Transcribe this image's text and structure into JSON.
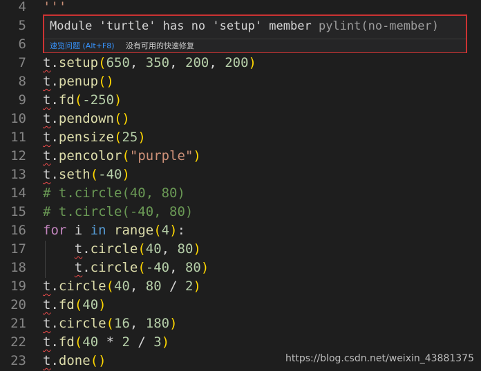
{
  "editor": {
    "lines": [
      {
        "num": "4",
        "tokens": [
          {
            "t": "'''",
            "c": "t-str"
          }
        ]
      },
      {
        "num": "5",
        "tokens": []
      },
      {
        "num": "6",
        "tokens": []
      },
      {
        "num": "7",
        "tokens": [
          {
            "t": "t",
            "c": "t-var squiggle"
          },
          {
            "t": ".",
            "c": "t-op"
          },
          {
            "t": "setup",
            "c": "t-fn"
          },
          {
            "t": "(",
            "c": "t-p1"
          },
          {
            "t": "650",
            "c": "t-num"
          },
          {
            "t": ", ",
            "c": "t-op"
          },
          {
            "t": "350",
            "c": "t-num"
          },
          {
            "t": ", ",
            "c": "t-op"
          },
          {
            "t": "200",
            "c": "t-num"
          },
          {
            "t": ", ",
            "c": "t-op"
          },
          {
            "t": "200",
            "c": "t-num"
          },
          {
            "t": ")",
            "c": "t-p1"
          }
        ]
      },
      {
        "num": "8",
        "tokens": [
          {
            "t": "t",
            "c": "t-var squiggle"
          },
          {
            "t": ".",
            "c": "t-op"
          },
          {
            "t": "penup",
            "c": "t-fn"
          },
          {
            "t": "()",
            "c": "t-p1"
          }
        ]
      },
      {
        "num": "9",
        "tokens": [
          {
            "t": "t",
            "c": "t-var squiggle"
          },
          {
            "t": ".",
            "c": "t-op"
          },
          {
            "t": "fd",
            "c": "t-fn"
          },
          {
            "t": "(",
            "c": "t-p1"
          },
          {
            "t": "-250",
            "c": "t-num"
          },
          {
            "t": ")",
            "c": "t-p1"
          }
        ]
      },
      {
        "num": "10",
        "tokens": [
          {
            "t": "t",
            "c": "t-var squiggle"
          },
          {
            "t": ".",
            "c": "t-op"
          },
          {
            "t": "pendown",
            "c": "t-fn"
          },
          {
            "t": "()",
            "c": "t-p1"
          }
        ]
      },
      {
        "num": "11",
        "tokens": [
          {
            "t": "t",
            "c": "t-var squiggle"
          },
          {
            "t": ".",
            "c": "t-op"
          },
          {
            "t": "pensize",
            "c": "t-fn"
          },
          {
            "t": "(",
            "c": "t-p1"
          },
          {
            "t": "25",
            "c": "t-num"
          },
          {
            "t": ")",
            "c": "t-p1"
          }
        ]
      },
      {
        "num": "12",
        "tokens": [
          {
            "t": "t",
            "c": "t-var squiggle"
          },
          {
            "t": ".",
            "c": "t-op"
          },
          {
            "t": "pencolor",
            "c": "t-fn"
          },
          {
            "t": "(",
            "c": "t-p1"
          },
          {
            "t": "\"purple\"",
            "c": "t-str"
          },
          {
            "t": ")",
            "c": "t-p1"
          }
        ]
      },
      {
        "num": "13",
        "tokens": [
          {
            "t": "t",
            "c": "t-var squiggle"
          },
          {
            "t": ".",
            "c": "t-op"
          },
          {
            "t": "seth",
            "c": "t-fn"
          },
          {
            "t": "(",
            "c": "t-p1"
          },
          {
            "t": "-40",
            "c": "t-num"
          },
          {
            "t": ")",
            "c": "t-p1"
          }
        ]
      },
      {
        "num": "14",
        "tokens": [
          {
            "t": "# t.circle(40, 80)",
            "c": "t-cmt"
          }
        ]
      },
      {
        "num": "15",
        "tokens": [
          {
            "t": "# t.circle(-40, 80)",
            "c": "t-cmt"
          }
        ]
      },
      {
        "num": "16",
        "tokens": [
          {
            "t": "for",
            "c": "t-kw"
          },
          {
            "t": " i ",
            "c": "t-var"
          },
          {
            "t": "in",
            "c": "t-kw2"
          },
          {
            "t": " ",
            "c": "t-op"
          },
          {
            "t": "range",
            "c": "t-fn"
          },
          {
            "t": "(",
            "c": "t-p1"
          },
          {
            "t": "4",
            "c": "t-num"
          },
          {
            "t": ")",
            "c": "t-p1"
          },
          {
            "t": ":",
            "c": "t-op"
          }
        ]
      },
      {
        "num": "17",
        "tokens": [
          {
            "t": "    ",
            "c": "t-op"
          },
          {
            "t": "t",
            "c": "t-var squiggle"
          },
          {
            "t": ".",
            "c": "t-op"
          },
          {
            "t": "circle",
            "c": "t-fn"
          },
          {
            "t": "(",
            "c": "t-p1"
          },
          {
            "t": "40",
            "c": "t-num"
          },
          {
            "t": ", ",
            "c": "t-op"
          },
          {
            "t": "80",
            "c": "t-num"
          },
          {
            "t": ")",
            "c": "t-p1"
          }
        ]
      },
      {
        "num": "18",
        "tokens": [
          {
            "t": "    ",
            "c": "t-op"
          },
          {
            "t": "t",
            "c": "t-var squiggle"
          },
          {
            "t": ".",
            "c": "t-op"
          },
          {
            "t": "circle",
            "c": "t-fn"
          },
          {
            "t": "(",
            "c": "t-p1"
          },
          {
            "t": "-40",
            "c": "t-num"
          },
          {
            "t": ", ",
            "c": "t-op"
          },
          {
            "t": "80",
            "c": "t-num"
          },
          {
            "t": ")",
            "c": "t-p1"
          }
        ]
      },
      {
        "num": "19",
        "tokens": [
          {
            "t": "t",
            "c": "t-var squiggle"
          },
          {
            "t": ".",
            "c": "t-op"
          },
          {
            "t": "circle",
            "c": "t-fn"
          },
          {
            "t": "(",
            "c": "t-p1"
          },
          {
            "t": "40",
            "c": "t-num"
          },
          {
            "t": ", ",
            "c": "t-op"
          },
          {
            "t": "80",
            "c": "t-num"
          },
          {
            "t": " / ",
            "c": "t-op"
          },
          {
            "t": "2",
            "c": "t-num"
          },
          {
            "t": ")",
            "c": "t-p1"
          }
        ]
      },
      {
        "num": "20",
        "tokens": [
          {
            "t": "t",
            "c": "t-var squiggle"
          },
          {
            "t": ".",
            "c": "t-op"
          },
          {
            "t": "fd",
            "c": "t-fn"
          },
          {
            "t": "(",
            "c": "t-p1"
          },
          {
            "t": "40",
            "c": "t-num"
          },
          {
            "t": ")",
            "c": "t-p1"
          }
        ]
      },
      {
        "num": "21",
        "tokens": [
          {
            "t": "t",
            "c": "t-var squiggle"
          },
          {
            "t": ".",
            "c": "t-op"
          },
          {
            "t": "circle",
            "c": "t-fn"
          },
          {
            "t": "(",
            "c": "t-p1"
          },
          {
            "t": "16",
            "c": "t-num"
          },
          {
            "t": ", ",
            "c": "t-op"
          },
          {
            "t": "180",
            "c": "t-num"
          },
          {
            "t": ")",
            "c": "t-p1"
          }
        ]
      },
      {
        "num": "22",
        "tokens": [
          {
            "t": "t",
            "c": "t-var squiggle"
          },
          {
            "t": ".",
            "c": "t-op"
          },
          {
            "t": "fd",
            "c": "t-fn"
          },
          {
            "t": "(",
            "c": "t-p1"
          },
          {
            "t": "40",
            "c": "t-num"
          },
          {
            "t": " * ",
            "c": "t-op"
          },
          {
            "t": "2",
            "c": "t-num"
          },
          {
            "t": " / ",
            "c": "t-op"
          },
          {
            "t": "3",
            "c": "t-num"
          },
          {
            "t": ")",
            "c": "t-p1"
          }
        ]
      },
      {
        "num": "23",
        "tokens": [
          {
            "t": "t",
            "c": "t-var squiggle"
          },
          {
            "t": ".",
            "c": "t-op"
          },
          {
            "t": "done",
            "c": "t-fn"
          },
          {
            "t": "()",
            "c": "t-p1"
          }
        ]
      }
    ]
  },
  "hover": {
    "message": "Module 'turtle' has no 'setup' member",
    "source": "pylint(no-member)",
    "peek_problem": "速览问题 (Alt+F8)",
    "no_quick_fix": "没有可用的快速修复"
  },
  "watermark": "https://blog.csdn.net/weixin_43881375",
  "colors": {
    "background": "#1e1e1e",
    "hover_border": "#cc3333",
    "error_squiggle": "#f14c4c",
    "link": "#3794ff"
  }
}
